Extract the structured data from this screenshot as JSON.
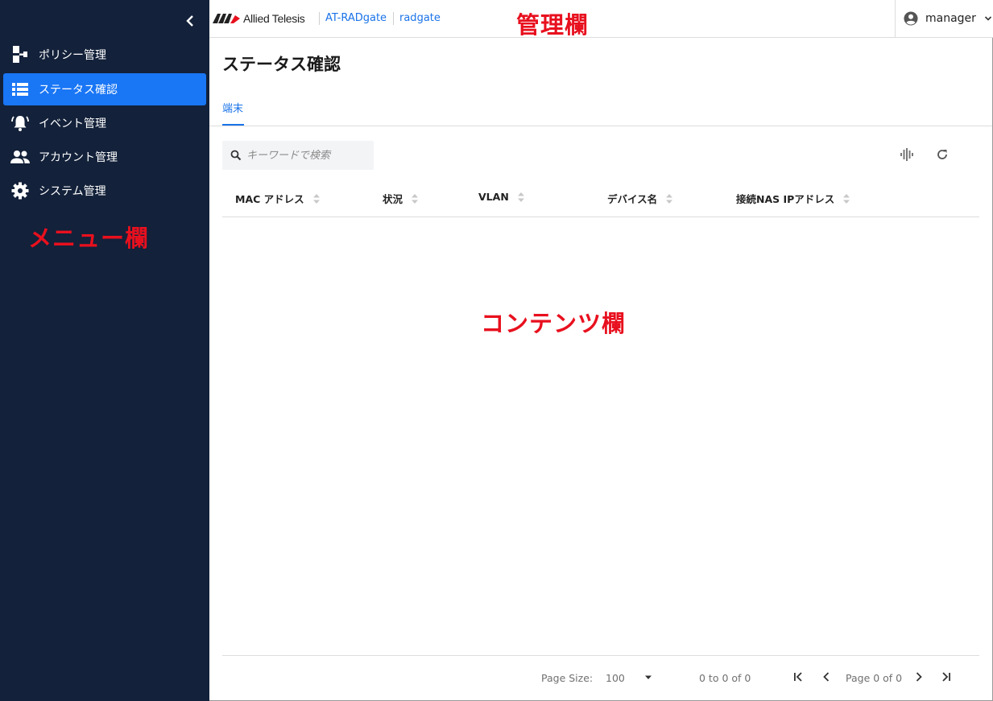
{
  "sidebar": {
    "collapse_icon": "chevron-left-icon",
    "items": [
      {
        "label": "ポリシー管理",
        "icon": "policy-tree-icon",
        "active": false
      },
      {
        "label": "ステータス確認",
        "icon": "list-icon",
        "active": true
      },
      {
        "label": "イベント管理",
        "icon": "bell-icon",
        "active": false
      },
      {
        "label": "アカウント管理",
        "icon": "people-icon",
        "active": false
      },
      {
        "label": "システム管理",
        "icon": "gear-icon",
        "active": false
      }
    ]
  },
  "header": {
    "logo_text": "Allied Telesis",
    "product_link": "AT-RADgate",
    "host_link": "radgate",
    "user": "manager"
  },
  "annotations": {
    "admin_area": "管理欄",
    "menu_area": "メニュー欄",
    "content_area": "コンテンツ欄"
  },
  "main": {
    "page_title": "ステータス確認",
    "tabs": [
      {
        "label": "端末",
        "active": true
      }
    ],
    "search": {
      "placeholder": "キーワードで検索",
      "value": ""
    },
    "toolbar": {
      "icons": [
        "columns-icon",
        "refresh-icon"
      ]
    },
    "table": {
      "columns": [
        "MAC アドレス",
        "状況",
        "VLAN",
        "デバイス名",
        "接続NAS IPアドレス"
      ],
      "rows": []
    },
    "pagination": {
      "page_size_label": "Page Size:",
      "page_size": "100",
      "range": "0 to 0 of 0",
      "page_info": "Page 0 of 0"
    }
  },
  "colors": {
    "sidebar_bg": "#13213a",
    "accent": "#1976f5",
    "link": "#1a73e8",
    "annotation": "#e8101e"
  }
}
